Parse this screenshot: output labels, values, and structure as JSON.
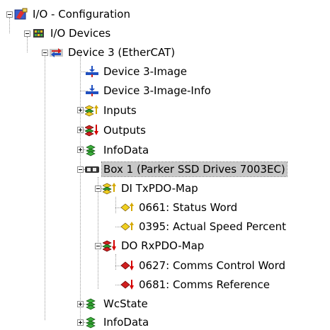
{
  "tree": {
    "nodes": [
      {
        "label": "I/O - Configuration",
        "icon": "io-config-icon"
      },
      {
        "label": "I/O Devices",
        "icon": "io-devices-icon"
      },
      {
        "label": "Device 3 (EtherCAT)",
        "icon": "ethercat-device-icon"
      },
      {
        "label": "Device 3-Image",
        "icon": "process-image-icon"
      },
      {
        "label": "Device 3-Image-Info",
        "icon": "process-image-icon"
      },
      {
        "label": "Inputs",
        "icon": "inputs-icon"
      },
      {
        "label": "Outputs",
        "icon": "outputs-icon"
      },
      {
        "label": "InfoData",
        "icon": "infodata-icon"
      },
      {
        "label": "Box 1 (Parker SSD Drives 7003EC)",
        "icon": "box-icon"
      },
      {
        "label": "DI TxPDO-Map",
        "icon": "inputs-icon"
      },
      {
        "label": "0661: Status Word",
        "icon": "input-variable-icon"
      },
      {
        "label": "0395: Actual Speed Percent",
        "icon": "input-variable-icon"
      },
      {
        "label": "DO RxPDO-Map",
        "icon": "outputs-icon"
      },
      {
        "label": "0627: Comms Control Word",
        "icon": "output-variable-icon"
      },
      {
        "label": "0681: Comms Reference",
        "icon": "output-variable-icon"
      },
      {
        "label": "WcState",
        "icon": "infodata-icon"
      },
      {
        "label": "InfoData",
        "icon": "infodata-icon"
      }
    ],
    "colors": {
      "selection": "#c8c8c8",
      "input_arrow": "#d4a800",
      "output_arrow": "#d40000",
      "green_cube": "#2e9b2e"
    }
  }
}
